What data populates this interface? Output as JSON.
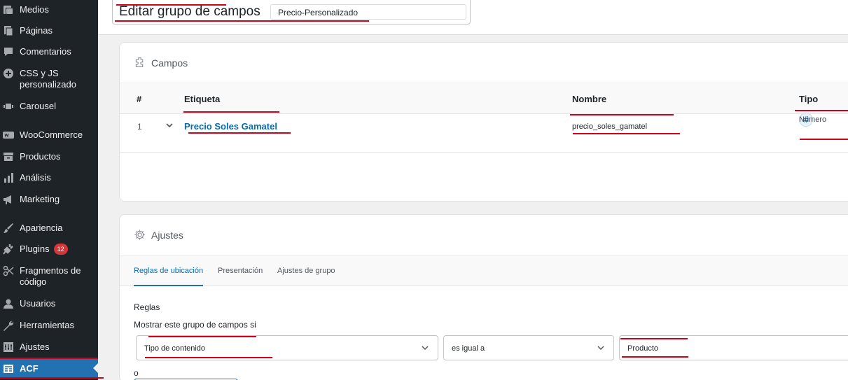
{
  "sidebar": {
    "items": [
      {
        "label": "Medios",
        "icon": "media-icon"
      },
      {
        "label": "Páginas",
        "icon": "pages-icon"
      },
      {
        "label": "Comentarios",
        "icon": "comments-icon"
      },
      {
        "label": "CSS y JS personalizado",
        "icon": "plus-circle-icon"
      },
      {
        "label": "Carousel",
        "icon": "carousel-icon"
      },
      {
        "label": "WooCommerce",
        "icon": "woocommerce-icon"
      },
      {
        "label": "Productos",
        "icon": "archive-icon"
      },
      {
        "label": "Análisis",
        "icon": "bar-chart-icon"
      },
      {
        "label": "Marketing",
        "icon": "megaphone-icon"
      },
      {
        "label": "Apariencia",
        "icon": "brush-icon"
      },
      {
        "label": "Plugins",
        "icon": "plug-icon",
        "badge": "12"
      },
      {
        "label": "Fragmentos de código",
        "icon": "scissors-icon"
      },
      {
        "label": "Usuarios",
        "icon": "user-icon"
      },
      {
        "label": "Herramientas",
        "icon": "wrench-icon"
      },
      {
        "label": "Ajustes",
        "icon": "settings-icon"
      },
      {
        "label": "ACF",
        "icon": "acf-icon",
        "active": true
      }
    ],
    "accent_color": "#2271b1",
    "background_color": "#1d2327"
  },
  "header": {
    "title": "Editar grupo de campos",
    "group_name_value": "Precio-Personalizado"
  },
  "fields_panel": {
    "title": "Campos",
    "columns": {
      "num": "#",
      "label": "Etiqueta",
      "name": "Nombre",
      "type": "Tipo"
    },
    "rows": [
      {
        "num": "1",
        "label": "Precio Soles Gamatel",
        "name": "precio_soles_gamatel",
        "type": "Número",
        "type_icon_glyph": "#"
      }
    ]
  },
  "settings_panel": {
    "title": "Ajustes",
    "tabs": [
      {
        "label": "Reglas de ubicación",
        "active": true
      },
      {
        "label": "Presentación",
        "active": false
      },
      {
        "label": "Ajustes de grupo",
        "active": false
      }
    ],
    "rules_title": "Reglas",
    "rules_subtitle": "Mostrar este grupo de campos si",
    "rule": {
      "param": "Tipo de contenido",
      "operator": "es igual a",
      "value": "Producto"
    },
    "or_label": "o"
  },
  "annotation_color": "#d0021b"
}
